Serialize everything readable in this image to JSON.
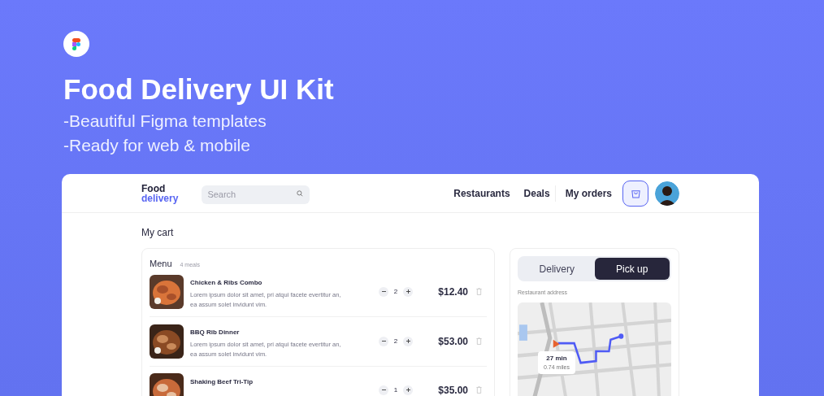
{
  "hero": {
    "title": "Food Delivery UI Kit",
    "lines": [
      "-Beautiful Figma templates",
      "-Ready for web & mobile"
    ]
  },
  "app": {
    "logo": [
      "Food",
      "delivery"
    ],
    "search": {
      "placeholder": "Search"
    },
    "nav": [
      "Restaurants",
      "Deals",
      "My orders"
    ],
    "page_title": "My cart",
    "menu": {
      "title": "Menu",
      "count": "4 meals",
      "items": [
        {
          "name": "Chicken & Ribs Combo",
          "description": "Lorem ipsum dolor sit amet, pri atqui facete evertitur an, ea assum solet invidunt vim.",
          "quantity": "2",
          "price": "$12.40"
        },
        {
          "name": "BBQ Rib Dinner",
          "description": "Lorem ipsum dolor sit amet, pri atqui facete evertitur an, ea assum solet invidunt vim.",
          "quantity": "2",
          "price": "$53.00"
        },
        {
          "name": "Shaking Beef Tri-Tip",
          "quantity": "1",
          "price": "$35.00"
        }
      ]
    },
    "mode_tabs": [
      {
        "label": "Delivery",
        "selected": false
      },
      {
        "label": "Pick up",
        "selected": true
      }
    ],
    "address_label": "Restaurant address",
    "route": {
      "time": "27 min",
      "distance": "0.74 miles"
    }
  }
}
